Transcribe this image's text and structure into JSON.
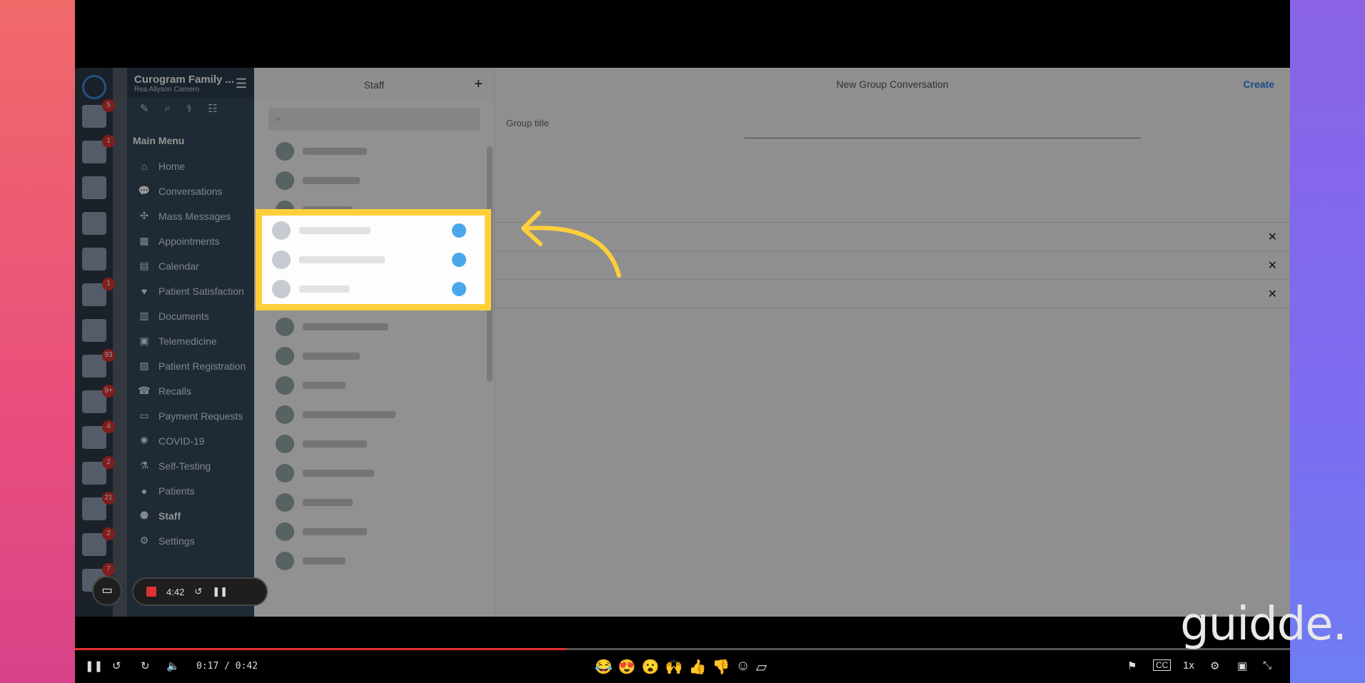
{
  "sidebar": {
    "title": "Curogram Family ...",
    "subtitle": "Rea Allyson Camero",
    "section": "Main Menu",
    "items": [
      {
        "label": "Home",
        "icon": "home-icon",
        "glyph": "⌂"
      },
      {
        "label": "Conversations",
        "icon": "chat-icon",
        "glyph": "💬"
      },
      {
        "label": "Mass Messages",
        "icon": "broadcast-icon",
        "glyph": "✣"
      },
      {
        "label": "Appointments",
        "icon": "appointments-icon",
        "glyph": "▦"
      },
      {
        "label": "Calendar",
        "icon": "calendar-icon",
        "glyph": "▤"
      },
      {
        "label": "Patient Satisfaction",
        "icon": "heart-icon",
        "glyph": "♥"
      },
      {
        "label": "Documents",
        "icon": "documents-icon",
        "glyph": "▥"
      },
      {
        "label": "Telemedicine",
        "icon": "telemedicine-icon",
        "glyph": "▣"
      },
      {
        "label": "Patient Registration",
        "icon": "registration-icon",
        "glyph": "▧"
      },
      {
        "label": "Recalls",
        "icon": "phone-icon",
        "glyph": "☎"
      },
      {
        "label": "Payment Requests",
        "icon": "card-icon",
        "glyph": "▭"
      },
      {
        "label": "COVID-19",
        "icon": "virus-icon",
        "glyph": "✺"
      },
      {
        "label": "Self-Testing",
        "icon": "flask-icon",
        "glyph": "⚗"
      },
      {
        "label": "Patients",
        "icon": "user-icon",
        "glyph": "●"
      },
      {
        "label": "Staff",
        "icon": "staff-icon",
        "glyph": "⚉",
        "active": true
      },
      {
        "label": "Settings",
        "icon": "gear-icon",
        "glyph": "⚙"
      }
    ]
  },
  "staff": {
    "title": "Staff"
  },
  "main": {
    "title": "New Group Conversation",
    "create_label": "Create",
    "group_title_label": "Group title"
  },
  "recorder": {
    "time": "4:42"
  },
  "player": {
    "time": "0:17 / 0:42",
    "progress": 0.405,
    "speed": "1x"
  },
  "rail_badges": [
    "5",
    "1",
    "",
    "",
    "",
    "1",
    "",
    "93",
    "9+",
    "4",
    "2",
    "21",
    "2",
    "7"
  ],
  "watermark": "guidde.",
  "colors": {
    "accent": "#2f80ed",
    "highlight": "#ffcf3a",
    "progress": "#e03030"
  }
}
